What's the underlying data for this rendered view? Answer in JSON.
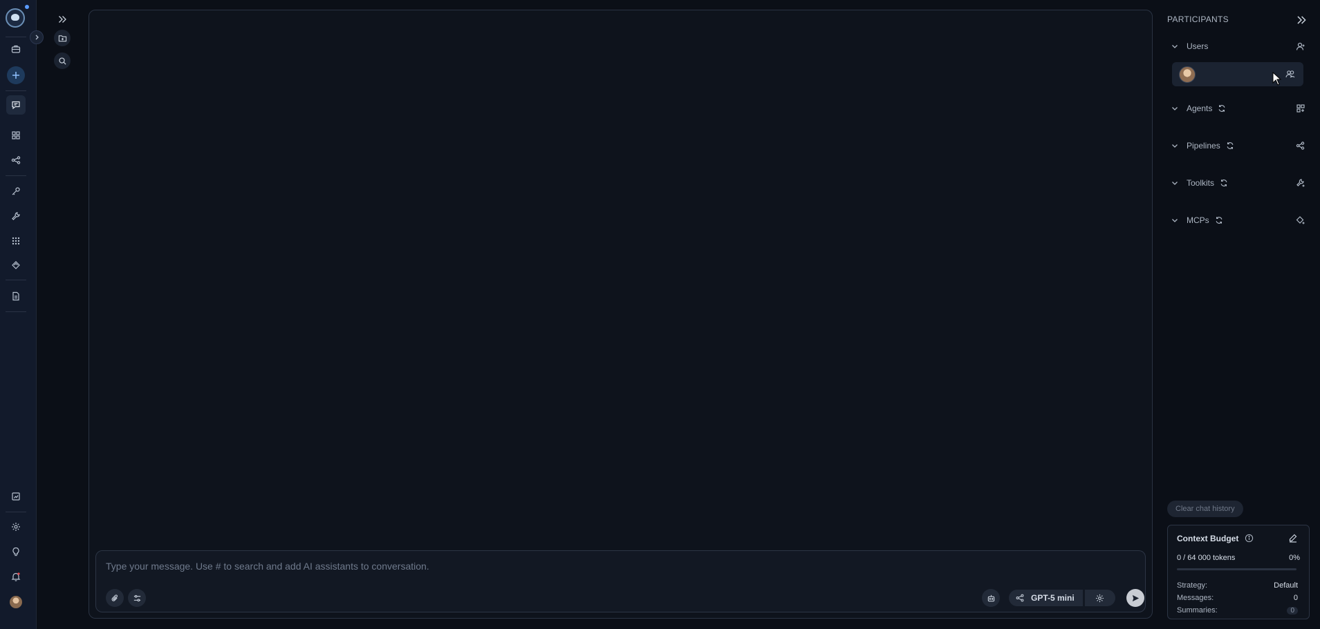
{
  "rail": {
    "items": [
      {
        "name": "credentials",
        "icon": "briefcase-icon"
      },
      {
        "name": "new",
        "icon": "plus-icon"
      },
      {
        "name": "chat",
        "icon": "chat-icon",
        "active": true
      },
      {
        "name": "agents",
        "icon": "grid-icon"
      },
      {
        "name": "pipelines",
        "icon": "workflow-icon"
      },
      {
        "name": "credentials-key",
        "icon": "key-icon"
      },
      {
        "name": "toolkits",
        "icon": "wrench-icon"
      },
      {
        "name": "apps",
        "icon": "apps-grid-icon"
      },
      {
        "name": "mcps",
        "icon": "mcp-icon"
      },
      {
        "name": "artifacts",
        "icon": "document-icon"
      },
      {
        "name": "reports",
        "icon": "report-icon"
      },
      {
        "name": "settings",
        "icon": "gear-icon"
      },
      {
        "name": "ideas",
        "icon": "lightbulb-icon"
      },
      {
        "name": "notifications",
        "icon": "bell-icon"
      }
    ],
    "accent": "#5b9cff",
    "notification_color": "#e5484d"
  },
  "composer": {
    "placeholder": "Type your message. Use # to search and add AI assistants to conversation.",
    "value": "",
    "model": "GPT-5 mini"
  },
  "participants": {
    "title": "PARTICIPANTS",
    "sections": {
      "users": "Users",
      "agents": "Agents",
      "pipelines": "Pipelines",
      "toolkits": "Toolkits",
      "mcps": "MCPs"
    }
  },
  "actions": {
    "clear_history": "Clear chat history"
  },
  "context_budget": {
    "title": "Context Budget",
    "tokens": "0 / 64 000 tokens",
    "percent": "0%",
    "used_fraction": 0,
    "strategy_label": "Strategy:",
    "strategy_value": "Default",
    "messages_label": "Messages:",
    "messages_value": "0",
    "summaries_label": "Summaries:",
    "summaries_value": "0"
  }
}
